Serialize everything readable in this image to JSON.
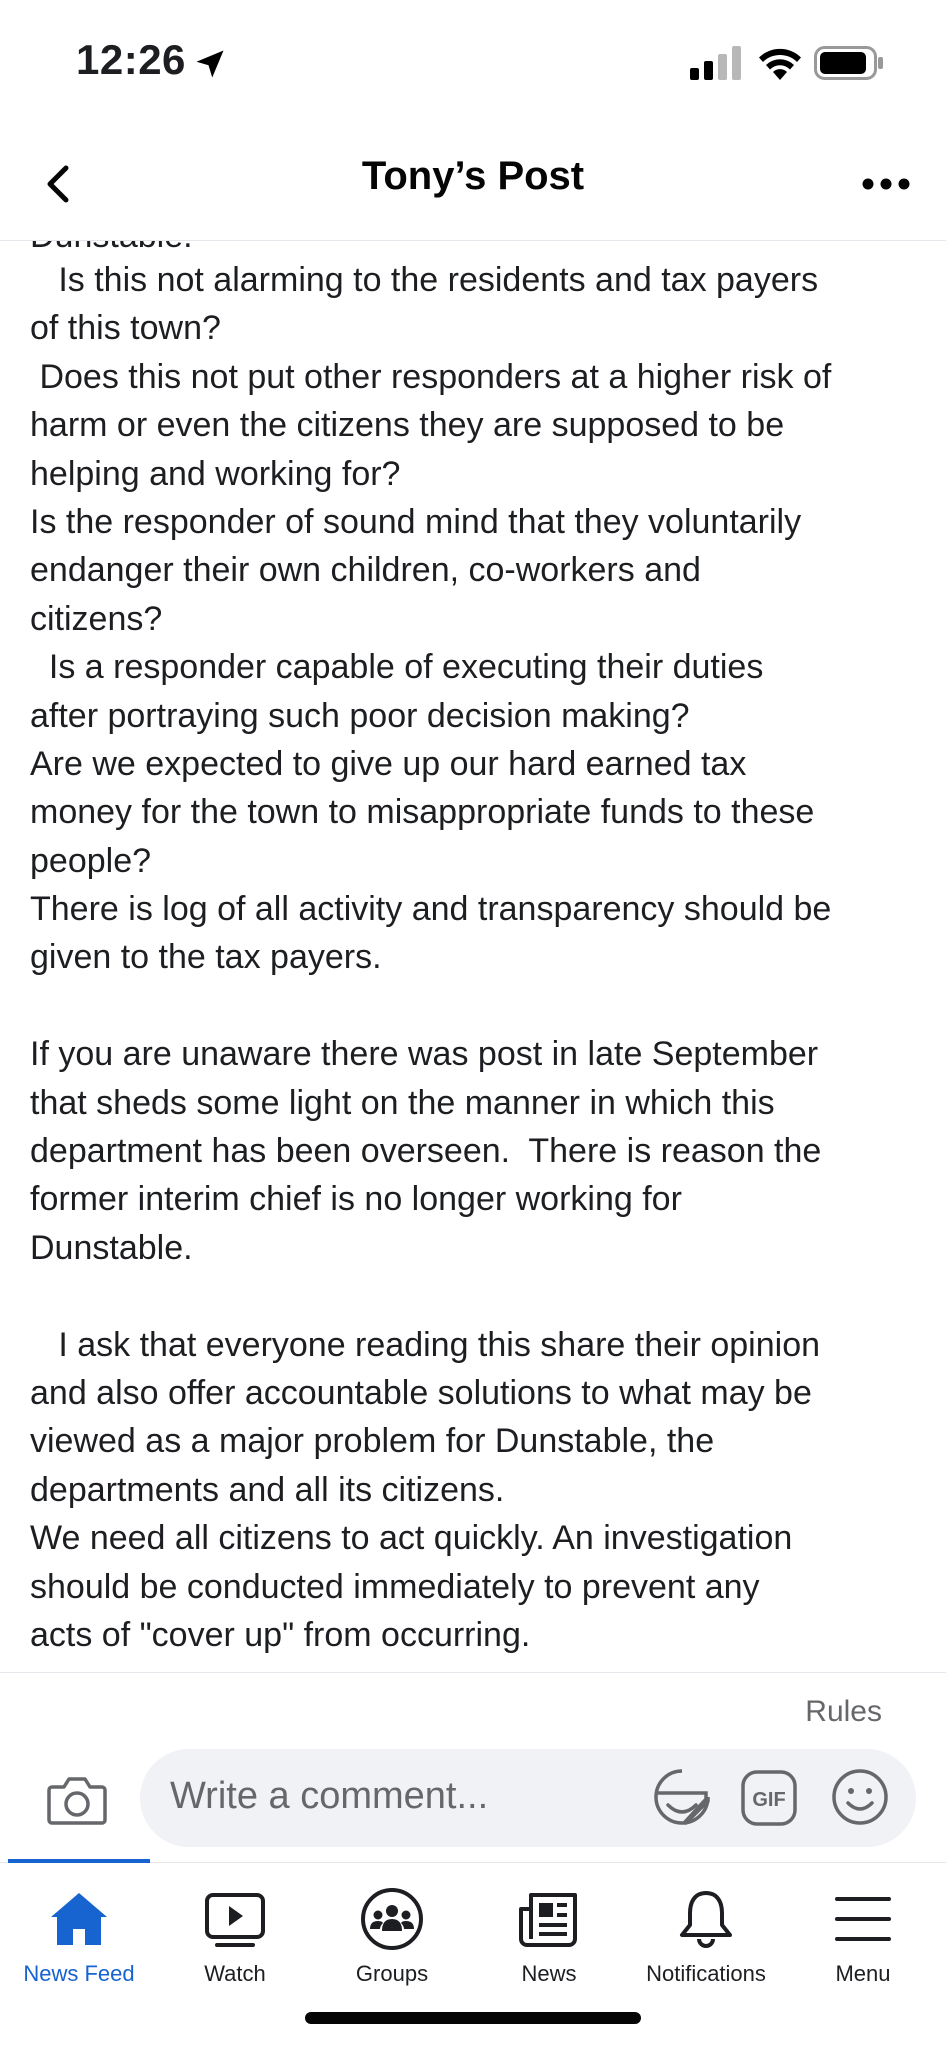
{
  "status_bar": {
    "time": "12:26"
  },
  "nav": {
    "title": "Tony’s Post"
  },
  "post": {
    "cut_line": "Dunstable.",
    "lines": [
      "   Is this not alarming to the residents and tax payers",
      "of this town?",
      " Does this not put other responders at a higher risk of",
      "harm or even the citizens they are supposed to be",
      "helping and working for?",
      "Is the responder of sound mind that they voluntarily",
      "endanger their own children, co-workers and",
      "citizens?",
      "  Is a responder capable of executing their duties",
      "after portraying such poor decision making?",
      "Are we expected to give up our hard earned tax",
      "money for the town to misappropriate funds to these",
      "people?",
      "There is log of all activity and transparency should be",
      "given to the tax payers.",
      "",
      "If you are unaware there was post in late September",
      "that sheds some light on the manner in which this",
      "department has been overseen.  There is reason the",
      "former interim chief is no longer working for",
      "Dunstable.",
      "",
      "   I ask that everyone reading this share their opinion",
      "and also offer accountable solutions to what may be",
      "viewed as a major problem for Dunstable, the",
      "departments and all its citizens.",
      "We need all citizens to act quickly. An investigation",
      "should be conducted immediately to prevent any",
      "acts of \"cover up\" from occurring."
    ]
  },
  "comment": {
    "rules_label": "Rules",
    "placeholder": "Write a comment..."
  },
  "tabs": [
    {
      "label": "News Feed",
      "icon": "home-icon",
      "active": true
    },
    {
      "label": "Watch",
      "icon": "watch-icon",
      "active": false
    },
    {
      "label": "Groups",
      "icon": "groups-icon",
      "active": false
    },
    {
      "label": "News",
      "icon": "news-icon",
      "active": false
    },
    {
      "label": "Notifications",
      "icon": "bell-icon",
      "active": false
    },
    {
      "label": "Menu",
      "icon": "hamburger-icon",
      "active": false
    }
  ],
  "colors": {
    "accent": "#1763cf",
    "muted": "#65676b",
    "input_bg": "#f0f2f5"
  }
}
